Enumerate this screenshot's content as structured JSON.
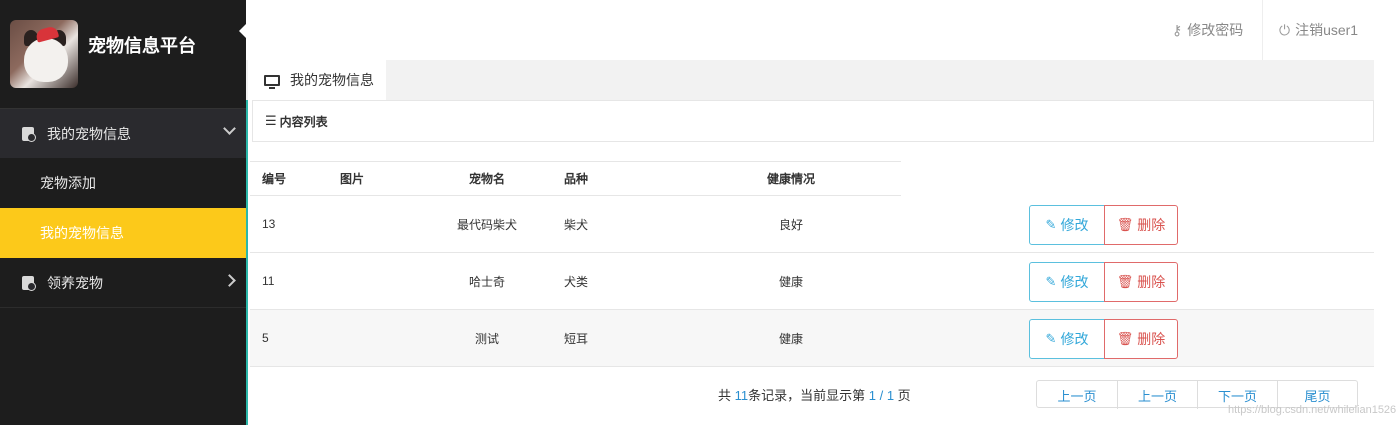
{
  "brand": {
    "title": "宠物信息平台"
  },
  "sidebar": {
    "items": [
      {
        "label": "我的宠物信息"
      },
      {
        "label": "宠物添加"
      },
      {
        "label": "我的宠物信息"
      },
      {
        "label": "领养宠物"
      }
    ]
  },
  "header": {
    "change_password": "修改密码",
    "logout": "注销user1"
  },
  "tab": {
    "label": "我的宠物信息"
  },
  "panel": {
    "title": "内容列表"
  },
  "table": {
    "columns": [
      "编号",
      "图片",
      "宠物名",
      "品种",
      "健康情况"
    ],
    "rows": [
      {
        "id": "13",
        "name": "最代码柴犬",
        "breed": "柴犬",
        "health": "良好"
      },
      {
        "id": "11",
        "name": "哈士奇",
        "breed": "犬类",
        "health": "健康"
      },
      {
        "id": "5",
        "name": "测试",
        "breed": "短耳",
        "health": "健康"
      }
    ],
    "edit_label": "修改",
    "delete_label": "删除"
  },
  "pagination": {
    "prefix": "共 ",
    "total": "11",
    "middle": "条记录，当前显示第 ",
    "page": "1 / 1",
    "suffix": " 页",
    "buttons": [
      "上一页",
      "上一页",
      "下一页",
      "尾页"
    ]
  },
  "watermark": "https://blog.csdn.net/whilelian1526"
}
